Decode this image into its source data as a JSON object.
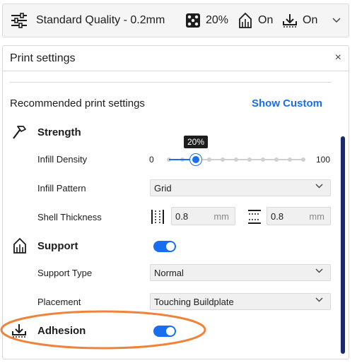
{
  "header": {
    "quality_label": "Standard Quality - 0.2mm",
    "infill_value": "20%",
    "support_value": "On",
    "adhesion_value": "On"
  },
  "panel": {
    "title": "Print settings",
    "close_glyph": "×",
    "recommended_label": "Recommended print settings",
    "show_custom_label": "Show Custom"
  },
  "strength": {
    "title": "Strength",
    "infill_density_label": "Infill Density",
    "slider_min": "0",
    "slider_max": "100",
    "slider_value": 20,
    "slider_tooltip": "20%",
    "infill_pattern_label": "Infill Pattern",
    "infill_pattern_value": "Grid",
    "shell_thickness_label": "Shell Thickness",
    "wall_thickness_value": "0.8",
    "wall_thickness_unit": "mm",
    "topbottom_thickness_value": "0.8",
    "topbottom_thickness_unit": "mm"
  },
  "support": {
    "title": "Support",
    "enabled": true,
    "type_label": "Support Type",
    "type_value": "Normal",
    "placement_label": "Placement",
    "placement_value": "Touching Buildplate"
  },
  "adhesion": {
    "title": "Adhesion",
    "enabled": true
  },
  "icons": {
    "header": [
      "settings-sliders-icon",
      "infill-icon",
      "support-icon",
      "adhesion-icon",
      "chevron-down-icon"
    ],
    "sections": [
      "hammer-icon",
      "support-icon",
      "adhesion-icon"
    ]
  },
  "colors": {
    "accent": "#196ef0",
    "scrollbar": "#1a2a72",
    "highlight": "#f0833a",
    "tooltip_bg": "#1d1d1d"
  }
}
